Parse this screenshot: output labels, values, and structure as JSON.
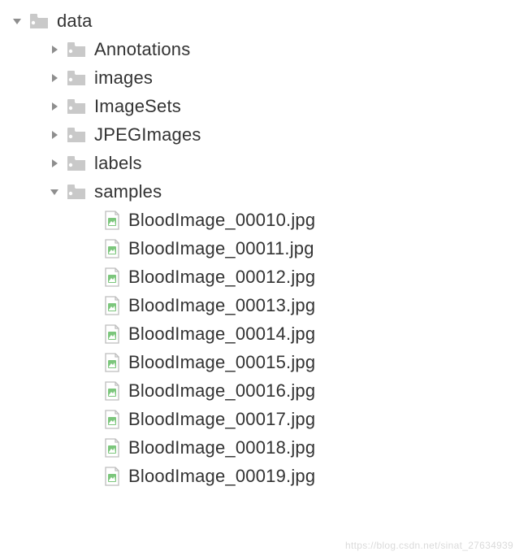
{
  "tree": {
    "root": {
      "name": "data",
      "expanded": true,
      "children": [
        {
          "name": "Annotations",
          "type": "folder",
          "expanded": false
        },
        {
          "name": "images",
          "type": "folder",
          "expanded": false
        },
        {
          "name": "ImageSets",
          "type": "folder",
          "expanded": false
        },
        {
          "name": "JPEGImages",
          "type": "folder",
          "expanded": false
        },
        {
          "name": "labels",
          "type": "folder",
          "expanded": false
        },
        {
          "name": "samples",
          "type": "folder",
          "expanded": true,
          "children": [
            {
              "name": "BloodImage_00010.jpg",
              "type": "image"
            },
            {
              "name": "BloodImage_00011.jpg",
              "type": "image"
            },
            {
              "name": "BloodImage_00012.jpg",
              "type": "image"
            },
            {
              "name": "BloodImage_00013.jpg",
              "type": "image"
            },
            {
              "name": "BloodImage_00014.jpg",
              "type": "image"
            },
            {
              "name": "BloodImage_00015.jpg",
              "type": "image"
            },
            {
              "name": "BloodImage_00016.jpg",
              "type": "image"
            },
            {
              "name": "BloodImage_00017.jpg",
              "type": "image"
            },
            {
              "name": "BloodImage_00018.jpg",
              "type": "image"
            },
            {
              "name": "BloodImage_00019.jpg",
              "type": "image"
            }
          ]
        }
      ]
    }
  },
  "watermark": "https://blog.csdn.net/sinat_27634939"
}
